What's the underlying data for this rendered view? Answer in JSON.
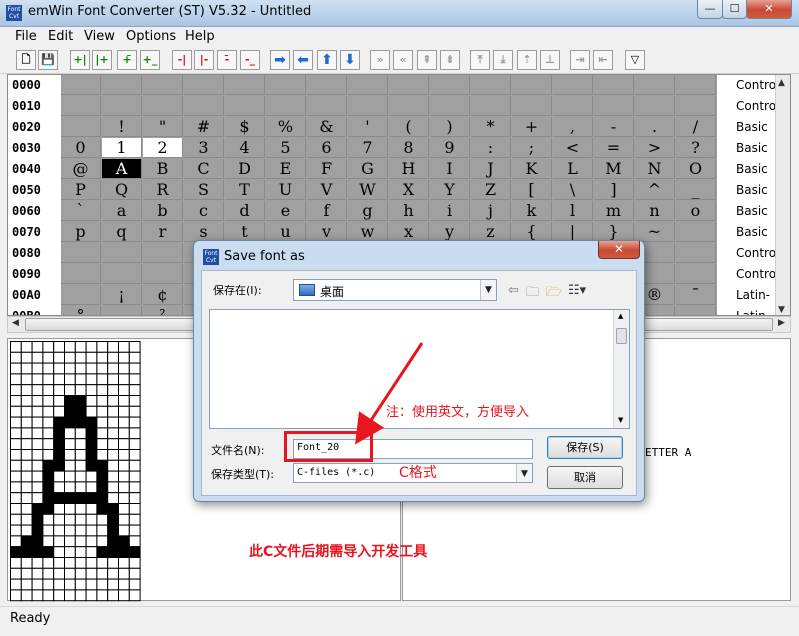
{
  "window": {
    "title": "emWin Font Converter (ST) V5.32 - Untitled",
    "icon_text": "Font Cvt",
    "min_glyph": "—",
    "max_glyph": "☐",
    "close_glyph": "✕"
  },
  "menu": [
    "File",
    "Edit",
    "View",
    "Options",
    "Help"
  ],
  "toolbar": [
    {
      "name": "new-file",
      "glyph": "🗋",
      "style": "plain"
    },
    {
      "name": "save-file",
      "glyph": "💾",
      "style": "plain"
    },
    {
      "name": "add-left",
      "glyph": "+|",
      "style": "green"
    },
    {
      "name": "add-right",
      "glyph": "|+",
      "style": "green"
    },
    {
      "name": "add-top",
      "glyph": "+̄",
      "style": "green"
    },
    {
      "name": "add-bottom",
      "glyph": "+_",
      "style": "green"
    },
    {
      "name": "remove-left",
      "glyph": "-|",
      "style": "red"
    },
    {
      "name": "remove-right",
      "glyph": "|-",
      "style": "red"
    },
    {
      "name": "remove-top",
      "glyph": "-̄",
      "style": "red"
    },
    {
      "name": "remove-bottom",
      "glyph": "-_",
      "style": "red"
    },
    {
      "name": "shift-right",
      "glyph": "➡",
      "style": "blue"
    },
    {
      "name": "shift-left",
      "glyph": "⬅",
      "style": "blue"
    },
    {
      "name": "shift-up",
      "glyph": "⬆",
      "style": "blue"
    },
    {
      "name": "shift-down",
      "glyph": "⬇",
      "style": "blue"
    },
    {
      "name": "move-all-right",
      "glyph": "»",
      "style": "grey"
    },
    {
      "name": "move-all-left",
      "glyph": "«",
      "style": "grey"
    },
    {
      "name": "move-all-up",
      "glyph": "⇞",
      "style": "grey"
    },
    {
      "name": "move-all-down",
      "glyph": "⇟",
      "style": "grey"
    },
    {
      "name": "align-top",
      "glyph": "⤒",
      "style": "grey"
    },
    {
      "name": "align-bottom",
      "glyph": "⤓",
      "style": "grey"
    },
    {
      "name": "align-up",
      "glyph": "⇡",
      "style": "grey"
    },
    {
      "name": "align-base",
      "glyph": "⊥",
      "style": "grey"
    },
    {
      "name": "align-right",
      "glyph": "⇥",
      "style": "grey"
    },
    {
      "name": "align-left",
      "glyph": "⇤",
      "style": "grey"
    },
    {
      "name": "filter",
      "glyph": "▽",
      "style": "plain"
    }
  ],
  "char_table": {
    "rows": [
      {
        "code": "0000",
        "cells": [
          "",
          "",
          "",
          "",
          "",
          "",
          "",
          "",
          "",
          "",
          "",
          "",
          "",
          "",
          "",
          ""
        ],
        "desc": "Contro"
      },
      {
        "code": "0010",
        "cells": [
          "",
          "",
          "",
          "",
          "",
          "",
          "",
          "",
          "",
          "",
          "",
          "",
          "",
          "",
          "",
          ""
        ],
        "desc": "Contro"
      },
      {
        "code": "0020",
        "cells": [
          "",
          "!",
          "\"",
          "#",
          "$",
          "%",
          "&",
          "'",
          "(",
          ")",
          "*",
          "+",
          ",",
          "-",
          ".",
          "/"
        ],
        "desc": "Basic"
      },
      {
        "code": "0030",
        "cells": [
          "0",
          "1",
          "2",
          "3",
          "4",
          "5",
          "6",
          "7",
          "8",
          "9",
          ":",
          ";",
          "<",
          "=",
          ">",
          "?"
        ],
        "desc": "Basic"
      },
      {
        "code": "0040",
        "cells": [
          "@",
          "A",
          "B",
          "C",
          "D",
          "E",
          "F",
          "G",
          "H",
          "I",
          "J",
          "K",
          "L",
          "M",
          "N",
          "O"
        ],
        "desc": "Basic"
      },
      {
        "code": "0050",
        "cells": [
          "P",
          "Q",
          "R",
          "S",
          "T",
          "U",
          "V",
          "W",
          "X",
          "Y",
          "Z",
          "[",
          "\\",
          "]",
          "^",
          "_"
        ],
        "desc": "Basic"
      },
      {
        "code": "0060",
        "cells": [
          "`",
          "a",
          "b",
          "c",
          "d",
          "e",
          "f",
          "g",
          "h",
          "i",
          "j",
          "k",
          "l",
          "m",
          "n",
          "o"
        ],
        "desc": "Basic"
      },
      {
        "code": "0070",
        "cells": [
          "p",
          "q",
          "r",
          "s",
          "t",
          "u",
          "v",
          "w",
          "x",
          "y",
          "z",
          "{",
          "|",
          "}",
          "~",
          ""
        ],
        "desc": "Basic"
      },
      {
        "code": "0080",
        "cells": [
          "",
          "",
          "",
          "",
          "",
          "",
          "",
          "",
          "",
          "",
          "",
          "",
          "",
          "",
          "",
          ""
        ],
        "desc": "Contro"
      },
      {
        "code": "0090",
        "cells": [
          "",
          "",
          "",
          "",
          "",
          "",
          "",
          "",
          "",
          "",
          "",
          "",
          "",
          "",
          "",
          ""
        ],
        "desc": "Contro"
      },
      {
        "code": "00A0",
        "cells": [
          "",
          "¡",
          "¢",
          "",
          "",
          "",
          "",
          "",
          "",
          "",
          "",
          "",
          "",
          "",
          "®",
          "¯"
        ],
        "desc": "Latin-"
      },
      {
        "code": "00B0",
        "cells": [
          "°",
          "",
          "²",
          "",
          "",
          "",
          "",
          "",
          "",
          "",
          "",
          "",
          "",
          "",
          "",
          ""
        ],
        "desc": "Latin-"
      }
    ],
    "white_cells": [
      "0030:1",
      "0030:2"
    ],
    "selected_cell": "0040:1"
  },
  "bitmap": {
    "cols": 12,
    "rows": 24,
    "black": [
      [
        5,
        6
      ],
      [
        6,
        6
      ],
      [
        5,
        5
      ],
      [
        6,
        5
      ],
      [
        4,
        7
      ],
      [
        5,
        7
      ],
      [
        6,
        7
      ],
      [
        7,
        7
      ],
      [
        4,
        8
      ],
      [
        7,
        8
      ],
      [
        4,
        9
      ],
      [
        7,
        9
      ],
      [
        4,
        10
      ],
      [
        7,
        10
      ],
      [
        3,
        11
      ],
      [
        4,
        11
      ],
      [
        7,
        11
      ],
      [
        8,
        11
      ],
      [
        3,
        12
      ],
      [
        8,
        12
      ],
      [
        3,
        13
      ],
      [
        8,
        13
      ],
      [
        3,
        14
      ],
      [
        4,
        14
      ],
      [
        5,
        14
      ],
      [
        6,
        14
      ],
      [
        7,
        14
      ],
      [
        8,
        14
      ],
      [
        2,
        15
      ],
      [
        3,
        15
      ],
      [
        8,
        15
      ],
      [
        9,
        15
      ],
      [
        2,
        16
      ],
      [
        9,
        16
      ],
      [
        2,
        17
      ],
      [
        9,
        17
      ],
      [
        1,
        18
      ],
      [
        2,
        18
      ],
      [
        9,
        18
      ],
      [
        10,
        18
      ],
      [
        0,
        19
      ],
      [
        1,
        19
      ],
      [
        2,
        19
      ],
      [
        3,
        19
      ],
      [
        8,
        19
      ],
      [
        9,
        19
      ],
      [
        10,
        19
      ],
      [
        11,
        19
      ]
    ]
  },
  "right_pane_text": "ETTER A",
  "status": "Ready",
  "dialog": {
    "title": "Save font as",
    "icon_text": "Font Cvt",
    "close_glyph": "✕",
    "save_in_label": "保存在(I):",
    "save_in_value": "桌面",
    "nav_icons": [
      "⇦",
      "🗀",
      "🗁",
      "☷▾"
    ],
    "filename_label": "文件名(N):",
    "filename_value": "Font_20",
    "filetype_label": "保存类型(T):",
    "filetype_value": "C-files (*.c)",
    "save_button": "保存(S)",
    "cancel_button": "取消"
  },
  "annotations": {
    "english_note": "注：使用英文，方便导入",
    "c_format": "C格式",
    "import_note": "此C文件后期需导入开发工具",
    "color": "#e8141e"
  }
}
